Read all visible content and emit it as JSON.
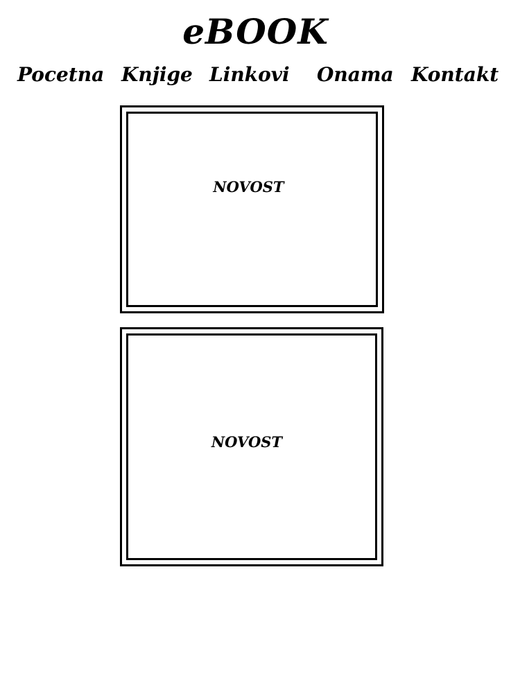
{
  "header": {
    "title": "eBOOK"
  },
  "nav": {
    "items": [
      {
        "label": "Pocetna"
      },
      {
        "label": "Knjige"
      },
      {
        "label": "Linkovi"
      },
      {
        "label": "Onama"
      },
      {
        "label": "Kontakt"
      }
    ]
  },
  "news": {
    "items": [
      {
        "label": "NOVOST"
      },
      {
        "label": "NOVOST"
      }
    ]
  }
}
